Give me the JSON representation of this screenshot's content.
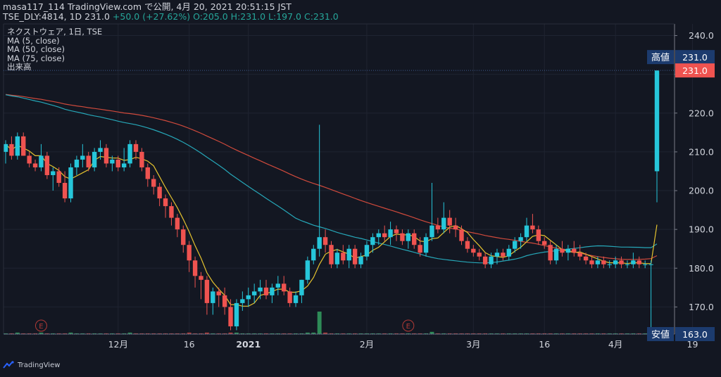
{
  "header": {
    "line1": "masa117_114 TradingView.com で公開, 4月 20, 2021 20:51:15 JST",
    "symbol": "TSE_DLY:4814, 1D 231.0",
    "change": "+50.0 (+27.62%)",
    "ohlc": "O:205.0 H:231.0 L:197.0 C:231.0"
  },
  "legend": {
    "title": "ネクストウェア, 1日, TSE",
    "ma5": "MA (5, close)",
    "ma50": "MA (50, close)",
    "ma75": "MA (75, close)",
    "volume": "出来高"
  },
  "price_badges": {
    "high_label": "高値",
    "high_value": "231.0",
    "last_value": "231.0",
    "low_label": "安値",
    "low_value": "163.0"
  },
  "footer": {
    "brand": "TradingView"
  },
  "colors": {
    "background": "#131722",
    "up": "#26c6da",
    "down": "#ef5350",
    "ma5": "#e5c32f",
    "ma50": "#26a7b8",
    "ma75": "#d04a3c",
    "badge": "#1c3b6e",
    "grid": "#1f2431"
  },
  "chart_data": {
    "type": "candlestick",
    "y_ticks": [
      "240.0",
      "230.0",
      "220.0",
      "210.0",
      "200.0",
      "190.0",
      "180.0",
      "170.0"
    ],
    "ylim": [
      163,
      243
    ],
    "x_ticks": [
      {
        "label": "12月",
        "bar": 19
      },
      {
        "label": "16",
        "bar": 31
      },
      {
        "label": "2021",
        "bar": 41
      },
      {
        "label": "2月",
        "bar": 61
      },
      {
        "label": "3月",
        "bar": 79
      },
      {
        "label": "16",
        "bar": 91
      },
      {
        "label": "4月",
        "bar": 103
      },
      {
        "label": "19",
        "bar": 116
      }
    ],
    "earnings_marker": "E",
    "earnings_bars": [
      6,
      68
    ],
    "candles": [
      [
        210,
        213,
        207,
        212
      ],
      [
        212,
        214,
        208,
        209
      ],
      [
        209,
        215,
        208,
        214
      ],
      [
        214,
        215,
        209,
        209
      ],
      [
        209,
        210,
        206,
        207
      ],
      [
        207,
        208,
        205,
        206
      ],
      [
        206,
        212,
        205,
        209
      ],
      [
        209,
        210,
        203,
        204
      ],
      [
        204,
        206,
        200,
        205
      ],
      [
        205,
        206,
        201,
        202
      ],
      [
        202,
        205,
        197,
        198
      ],
      [
        198,
        207,
        197,
        206
      ],
      [
        206,
        209,
        204,
        208
      ],
      [
        208,
        212,
        206,
        209
      ],
      [
        209,
        210,
        205,
        206
      ],
      [
        206,
        211,
        205,
        210
      ],
      [
        210,
        213,
        208,
        211
      ],
      [
        211,
        212,
        206,
        207
      ],
      [
        207,
        209,
        205,
        208
      ],
      [
        208,
        209,
        205,
        206
      ],
      [
        206,
        211,
        205,
        207
      ],
      [
        207,
        213,
        206,
        212
      ],
      [
        212,
        213,
        208,
        210
      ],
      [
        210,
        211,
        205,
        206
      ],
      [
        206,
        207,
        201,
        203
      ],
      [
        203,
        204,
        199,
        201
      ],
      [
        201,
        202,
        196,
        198
      ],
      [
        198,
        199,
        193,
        196
      ],
      [
        196,
        197,
        191,
        193
      ],
      [
        193,
        194,
        188,
        190
      ],
      [
        190,
        191,
        184,
        186
      ],
      [
        186,
        187,
        179,
        182
      ],
      [
        182,
        183,
        175,
        178
      ],
      [
        178,
        179,
        172,
        177
      ],
      [
        177,
        178,
        168,
        171
      ],
      [
        171,
        175,
        168,
        174
      ],
      [
        174,
        175,
        170,
        173
      ],
      [
        173,
        175,
        168,
        170
      ],
      [
        170,
        172,
        164,
        165
      ],
      [
        165,
        172,
        164,
        171
      ],
      [
        171,
        174,
        169,
        172
      ],
      [
        172,
        175,
        170,
        173
      ],
      [
        173,
        176,
        171,
        174
      ],
      [
        174,
        177,
        172,
        175
      ],
      [
        175,
        177,
        172,
        173
      ],
      [
        173,
        176,
        171,
        175
      ],
      [
        175,
        178,
        173,
        176
      ],
      [
        176,
        178,
        173,
        174
      ],
      [
        174,
        175,
        170,
        171
      ],
      [
        171,
        174,
        170,
        173
      ],
      [
        173,
        177,
        171,
        177
      ],
      [
        177,
        183,
        176,
        182
      ],
      [
        182,
        186,
        181,
        185
      ],
      [
        185,
        217,
        183,
        188
      ],
      [
        188,
        190,
        184,
        186
      ],
      [
        186,
        187,
        180,
        181
      ],
      [
        181,
        185,
        180,
        184
      ],
      [
        184,
        186,
        181,
        182
      ],
      [
        182,
        186,
        180,
        185
      ],
      [
        185,
        186,
        180,
        181
      ],
      [
        181,
        184,
        180,
        183
      ],
      [
        183,
        187,
        182,
        186
      ],
      [
        186,
        189,
        184,
        188
      ],
      [
        188,
        190,
        186,
        189
      ],
      [
        189,
        191,
        187,
        188
      ],
      [
        188,
        192,
        186,
        190
      ],
      [
        190,
        191,
        187,
        189
      ],
      [
        189,
        190,
        186,
        187
      ],
      [
        187,
        190,
        185,
        189
      ],
      [
        189,
        190,
        185,
        186
      ],
      [
        186,
        188,
        183,
        184
      ],
      [
        184,
        189,
        183,
        188
      ],
      [
        188,
        202,
        187,
        191
      ],
      [
        191,
        193,
        189,
        190
      ],
      [
        190,
        197,
        189,
        193
      ],
      [
        193,
        195,
        189,
        191
      ],
      [
        191,
        193,
        188,
        190
      ],
      [
        190,
        191,
        186,
        187
      ],
      [
        187,
        188,
        184,
        185
      ],
      [
        185,
        186,
        183,
        184
      ],
      [
        184,
        185,
        182,
        183
      ],
      [
        183,
        184,
        180,
        181
      ],
      [
        181,
        184,
        180,
        183
      ],
      [
        183,
        185,
        181,
        184
      ],
      [
        184,
        185,
        182,
        183
      ],
      [
        183,
        186,
        182,
        185
      ],
      [
        185,
        188,
        184,
        187
      ],
      [
        187,
        189,
        185,
        188
      ],
      [
        188,
        193,
        187,
        191
      ],
      [
        191,
        194,
        189,
        190
      ],
      [
        190,
        191,
        186,
        187
      ],
      [
        187,
        188,
        185,
        186
      ],
      [
        186,
        187,
        181,
        182
      ],
      [
        182,
        186,
        181,
        185
      ],
      [
        185,
        187,
        183,
        184
      ],
      [
        184,
        186,
        182,
        185
      ],
      [
        185,
        187,
        183,
        184
      ],
      [
        184,
        186,
        182,
        183
      ],
      [
        183,
        184,
        181,
        182
      ],
      [
        182,
        183,
        180,
        181
      ],
      [
        181,
        183,
        180,
        182
      ],
      [
        182,
        183,
        180,
        181
      ],
      [
        181,
        182,
        180,
        181
      ],
      [
        181,
        183,
        180,
        182
      ],
      [
        182,
        183,
        180,
        181
      ],
      [
        181,
        182,
        180,
        181
      ],
      [
        181,
        184,
        180,
        182
      ],
      [
        182,
        183,
        180,
        181
      ],
      [
        181,
        182,
        180,
        181
      ],
      [
        181,
        182,
        163,
        181
      ],
      [
        205,
        231,
        197,
        231
      ]
    ],
    "volume": [
      1,
      1,
      2,
      1,
      1,
      1,
      2,
      1,
      1,
      1,
      1,
      2,
      1,
      1,
      1,
      1,
      1,
      1,
      1,
      1,
      1,
      2,
      1,
      1,
      1,
      1,
      1,
      1,
      1,
      1,
      1,
      2,
      1,
      1,
      2,
      1,
      1,
      1,
      2,
      2,
      1,
      1,
      1,
      1,
      1,
      1,
      1,
      1,
      1,
      1,
      1,
      2,
      2,
      30,
      2,
      1,
      1,
      1,
      1,
      1,
      1,
      1,
      1,
      1,
      1,
      1,
      1,
      1,
      1,
      1,
      1,
      1,
      3,
      1,
      1,
      1,
      1,
      1,
      1,
      1,
      1,
      1,
      1,
      1,
      1,
      1,
      1,
      1,
      1,
      1,
      1,
      1,
      1,
      1,
      1,
      1,
      1,
      1,
      1,
      1,
      1,
      1,
      1,
      1,
      1,
      1,
      1,
      1,
      1,
      3,
      6
    ]
  }
}
